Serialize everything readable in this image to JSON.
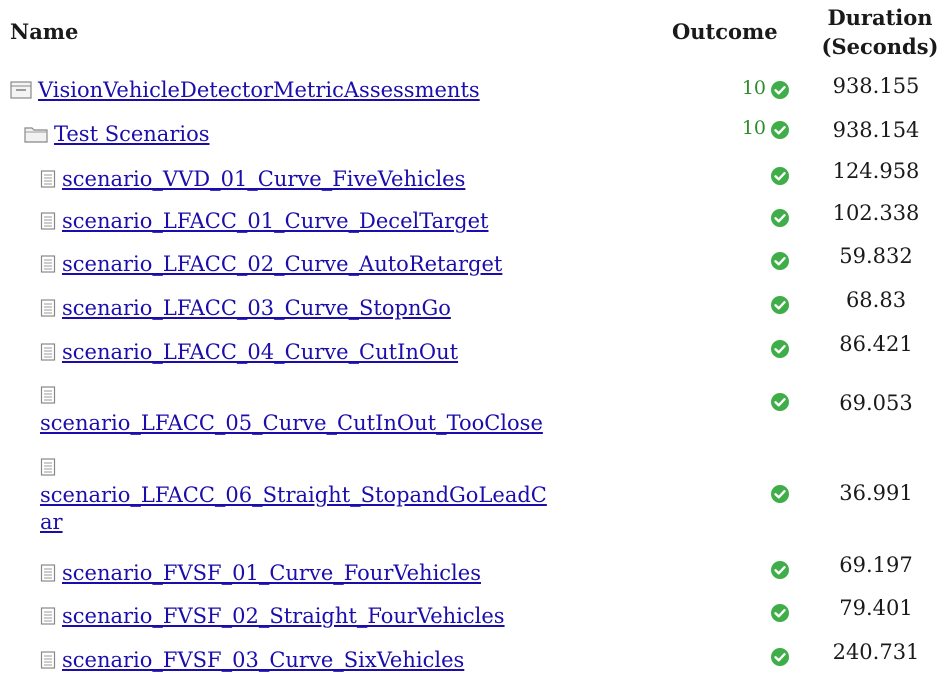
{
  "header": {
    "name_label": "Name",
    "outcome_label": "Outcome",
    "duration_label_line1": "Duration",
    "duration_label_line2": "(Seconds)"
  },
  "rows": [
    {
      "label": "VisionVehicleDetectorMetricAssessments",
      "count": "10",
      "duration": "938.155",
      "icon": "collapse-box-icon"
    },
    {
      "label": "Test Scenarios",
      "count": "10",
      "duration": "938.154",
      "icon": "folder-icon"
    },
    {
      "label": "scenario_VVD_01_Curve_FiveVehicles",
      "count": "",
      "duration": "124.958",
      "icon": "document-icon"
    },
    {
      "label": "scenario_LFACC_01_Curve_DecelTarget",
      "count": "",
      "duration": "102.338",
      "icon": "document-icon"
    },
    {
      "label": "scenario_LFACC_02_Curve_AutoRetarget",
      "count": "",
      "duration": "59.832",
      "icon": "document-icon"
    },
    {
      "label": "scenario_LFACC_03_Curve_StopnGo",
      "count": "",
      "duration": "68.83",
      "icon": "document-icon"
    },
    {
      "label": "scenario_LFACC_04_Curve_CutInOut",
      "count": "",
      "duration": "86.421",
      "icon": "document-icon"
    },
    {
      "label": "scenario_LFACC_05_Curve_CutInOut_TooClose",
      "count": "",
      "duration": "69.053",
      "icon": "document-icon"
    },
    {
      "label_line1": "scenario_LFACC_06_Straight_StopandGoLeadC",
      "label_line2": "ar",
      "count": "",
      "duration": "36.991",
      "icon": "document-icon"
    },
    {
      "label": "scenario_FVSF_01_Curve_FourVehicles",
      "count": "",
      "duration": "69.197",
      "icon": "document-icon"
    },
    {
      "label": "scenario_FVSF_02_Straight_FourVehicles",
      "count": "",
      "duration": "79.401",
      "icon": "document-icon"
    },
    {
      "label": "scenario_FVSF_03_Curve_SixVehicles",
      "count": "",
      "duration": "240.731",
      "icon": "document-icon"
    }
  ],
  "colors": {
    "link": "#1a0dab",
    "pass": "#2e8b2e",
    "check_bg": "#3fae49"
  }
}
